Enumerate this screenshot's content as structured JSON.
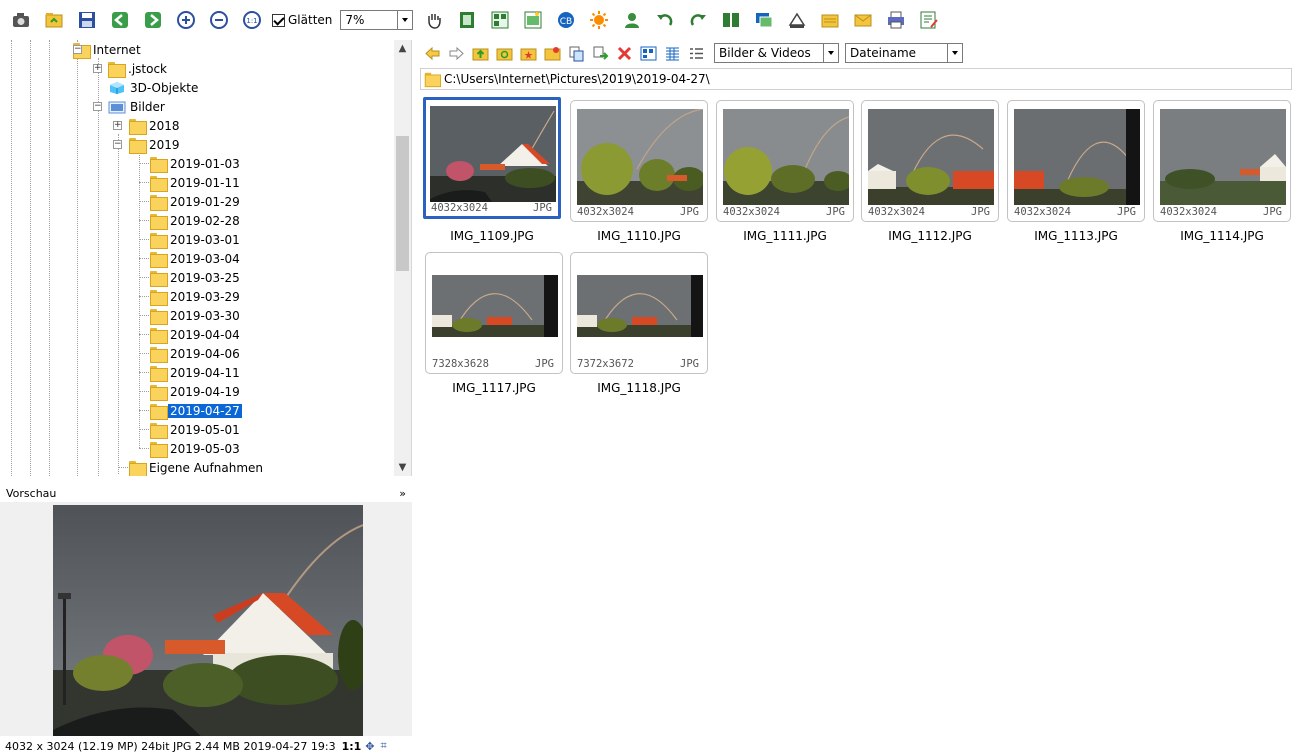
{
  "toolbar": {
    "smooth_label": "Glätten",
    "zoom_value": "7%"
  },
  "tree": {
    "items": [
      {
        "label": "Internet"
      },
      {
        "label": ".jstock"
      },
      {
        "label": "3D-Objekte"
      },
      {
        "label": "Bilder"
      },
      {
        "label": "2018"
      },
      {
        "label": "2019"
      },
      {
        "label": "2019-01-03"
      },
      {
        "label": "2019-01-11"
      },
      {
        "label": "2019-01-29"
      },
      {
        "label": "2019-02-28"
      },
      {
        "label": "2019-03-01"
      },
      {
        "label": "2019-03-04"
      },
      {
        "label": "2019-03-25"
      },
      {
        "label": "2019-03-29"
      },
      {
        "label": "2019-03-30"
      },
      {
        "label": "2019-04-04"
      },
      {
        "label": "2019-04-06"
      },
      {
        "label": "2019-04-11"
      },
      {
        "label": "2019-04-19"
      },
      {
        "label": "2019-04-27"
      },
      {
        "label": "2019-05-01"
      },
      {
        "label": "2019-05-03"
      },
      {
        "label": "Eigene Aufnahmen"
      }
    ],
    "selected": "2019-04-27"
  },
  "preview": {
    "title": "Vorschau",
    "status": "4032 x 3024 (12.19 MP)  24bit  JPG  2.44 MB  2019-04-27 19:3",
    "scale_label": "1:1"
  },
  "browser": {
    "filter_value": "Bilder & Videos",
    "sort_value": "Dateiname",
    "path": "C:\\Users\\Internet\\Pictures\\2019\\2019-04-27\\"
  },
  "thumbnails": [
    {
      "name": "IMG_1109.JPG",
      "dims": "4032x3024",
      "type": "JPG",
      "selected": true
    },
    {
      "name": "IMG_1110.JPG",
      "dims": "4032x3024",
      "type": "JPG",
      "selected": false
    },
    {
      "name": "IMG_1111.JPG",
      "dims": "4032x3024",
      "type": "JPG",
      "selected": false
    },
    {
      "name": "IMG_1112.JPG",
      "dims": "4032x3024",
      "type": "JPG",
      "selected": false
    },
    {
      "name": "IMG_1113.JPG",
      "dims": "4032x3024",
      "type": "JPG",
      "selected": false
    },
    {
      "name": "IMG_1114.JPG",
      "dims": "4032x3024",
      "type": "JPG",
      "selected": false
    },
    {
      "name": "IMG_1117.JPG",
      "dims": "7328x3628",
      "type": "JPG",
      "selected": false
    },
    {
      "name": "IMG_1118.JPG",
      "dims": "7372x3672",
      "type": "JPG",
      "selected": false
    }
  ],
  "colors": {
    "selection": "#0b67d6",
    "thumb_selected_border": "#2b62c2",
    "folder": "#f9d35c"
  }
}
